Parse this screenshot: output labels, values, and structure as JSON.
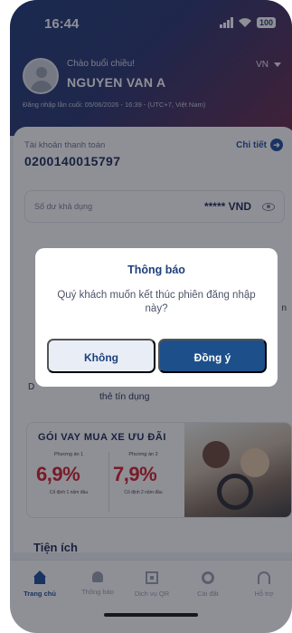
{
  "status_bar": {
    "time": "16:44",
    "battery": "100"
  },
  "header": {
    "greeting": "Chào buổi chiều!",
    "user_name": "NGUYEN VAN A",
    "language": "VN",
    "last_login": "Đăng nhập lần cuối: 05/06/2026 - 16:39 - (UTC+7, Việt Nam)"
  },
  "account": {
    "label": "Tài khoản thanh toán",
    "number": "0200140015797",
    "detail_link": "Chi tiết",
    "balance_label": "Số dư khả dụng",
    "balance_value": "***** VND"
  },
  "background_peek": {
    "left_fragment": "D",
    "right_fragment": "n",
    "credit_card_label": "thẻ tín dụng"
  },
  "promo": {
    "title": "GÓI VAY MUA XE ƯU ĐÃI",
    "plan_1": {
      "label": "Phương án 1",
      "rate": "6,9%",
      "note": "Cố định 1 năm đầu"
    },
    "plan_2": {
      "label": "Phương án 2",
      "rate": "7,9%",
      "note": "Cố định 2 năm đầu"
    }
  },
  "utilities_title": "Tiện ích",
  "tab_bar": {
    "items": [
      {
        "label": "Trang chủ",
        "icon": "home-icon",
        "active": true
      },
      {
        "label": "Thông báo",
        "icon": "bell-icon",
        "active": false
      },
      {
        "label": "Dịch vụ QR",
        "icon": "qr-icon",
        "active": false
      },
      {
        "label": "Cài đặt",
        "icon": "gear-icon",
        "active": false
      },
      {
        "label": "Hỗ trợ",
        "icon": "support-icon",
        "active": false
      }
    ]
  },
  "dialog": {
    "title": "Thông báo",
    "message": "Quý khách muốn kết thúc phiên đăng nhập này?",
    "cancel_label": "Không",
    "confirm_label": "Đồng ý"
  },
  "colors": {
    "primary": "#1d4f8a",
    "accent_red": "#d41f2b",
    "header_gradient_start": "#1f3c7a",
    "header_gradient_end": "#6a2a4a"
  }
}
